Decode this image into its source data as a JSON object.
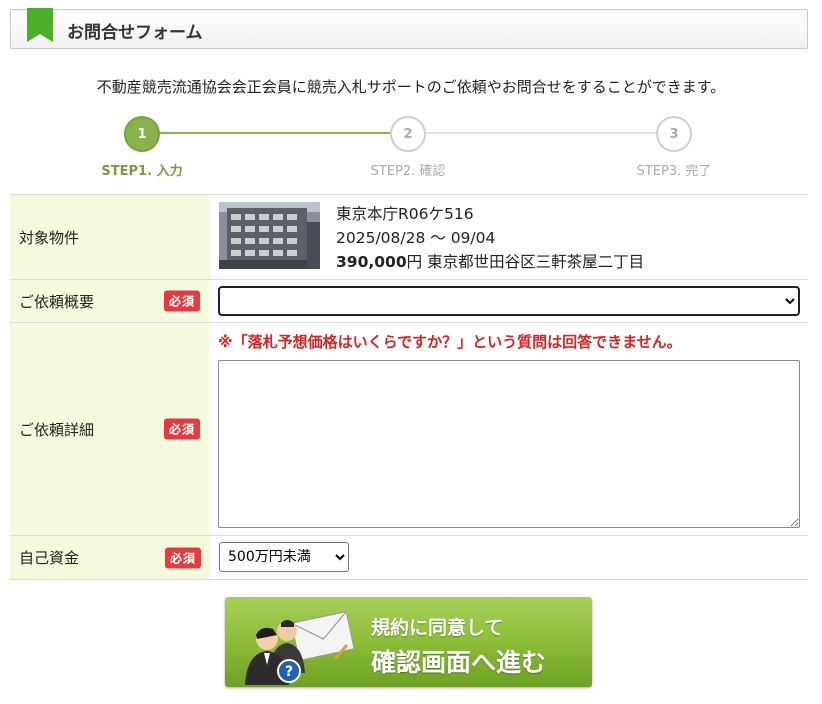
{
  "header": {
    "title": "お問合せフォーム",
    "accent_color": "#4caf2a"
  },
  "intro": "不動産競売流通協会会正会員に競売入札サポートのご依頼やお問合せをすることができます。",
  "steps": [
    {
      "number": "1",
      "label": "STEP1. 入力",
      "active": true
    },
    {
      "number": "2",
      "label": "STEP2. 確認",
      "active": false
    },
    {
      "number": "3",
      "label": "STEP3. 完了",
      "active": false
    }
  ],
  "form": {
    "property": {
      "label": "対象物件",
      "name": "東京本庁R06ケ516",
      "period": "2025/08/28 〜 09/04",
      "price": "390,000",
      "price_unit": "円",
      "address": "東京都世田谷区三軒茶屋二丁目"
    },
    "summary": {
      "label": "ご依頼概要",
      "required_badge": "必須",
      "selected": ""
    },
    "detail": {
      "label": "ご依頼詳細",
      "required_badge": "必須",
      "warning": "※「落札予想価格はいくらですか？」という質問は回答できません。",
      "value": ""
    },
    "funds": {
      "label": "自己資金",
      "required_badge": "必須",
      "selected": "500万円未満"
    }
  },
  "submit": {
    "line1": "規約に同意して",
    "line2": "確認画面へ進む"
  },
  "colors": {
    "required": "#e8393d",
    "label_bg": "#f4fadc",
    "step_active": "#8ab24a",
    "warning": "#e02020"
  }
}
